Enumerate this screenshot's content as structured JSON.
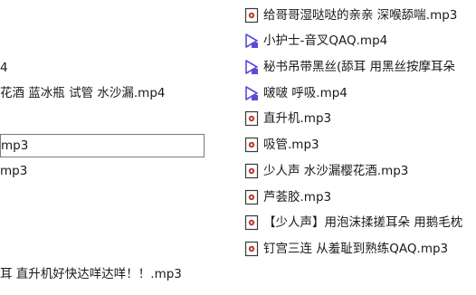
{
  "files_left": [
    {
      "name": "4"
    },
    {
      "name": "花酒 蓝冰瓶 试管 水沙漏.mp4"
    },
    {
      "name": "mp3",
      "selected": true
    },
    {
      "name": "mp3"
    },
    {
      "name": "耳 直升机好快达咩达咩！！.mp3"
    }
  ],
  "files_right": [
    {
      "name": "给哥哥湿哒哒的亲亲 深喉舔喘.mp3",
      "icon": "audio-file-icon"
    },
    {
      "name": "小护士-音叉QAQ.mp4",
      "icon": "video-file-icon"
    },
    {
      "name": "秘书吊带黑丝(舔耳 用黑丝按摩耳朵",
      "icon": "video-file-icon"
    },
    {
      "name": "啵啵 呼吸.mp4",
      "icon": "video-file-icon"
    },
    {
      "name": "直升机.mp3",
      "icon": "audio-file-icon"
    },
    {
      "name": "吸管.mp3",
      "icon": "audio-file-icon"
    },
    {
      "name": "少人声 水沙漏樱花酒.mp3",
      "icon": "audio-file-icon"
    },
    {
      "name": "芦荟胶.mp3",
      "icon": "audio-file-icon"
    },
    {
      "name": "【少人声】用泡沫揉搓耳朵 用鹅毛枕",
      "icon": "audio-file-icon"
    },
    {
      "name": "钉宫三连 从羞耻到熟练QAQ.mp3",
      "icon": "audio-file-icon"
    }
  ],
  "colors": {
    "video_icon": "#5b4bd6",
    "audio_icon_border": "#3a3a3a",
    "audio_icon_dot": "#c0392b",
    "selection_border": "#7a7a7a"
  }
}
